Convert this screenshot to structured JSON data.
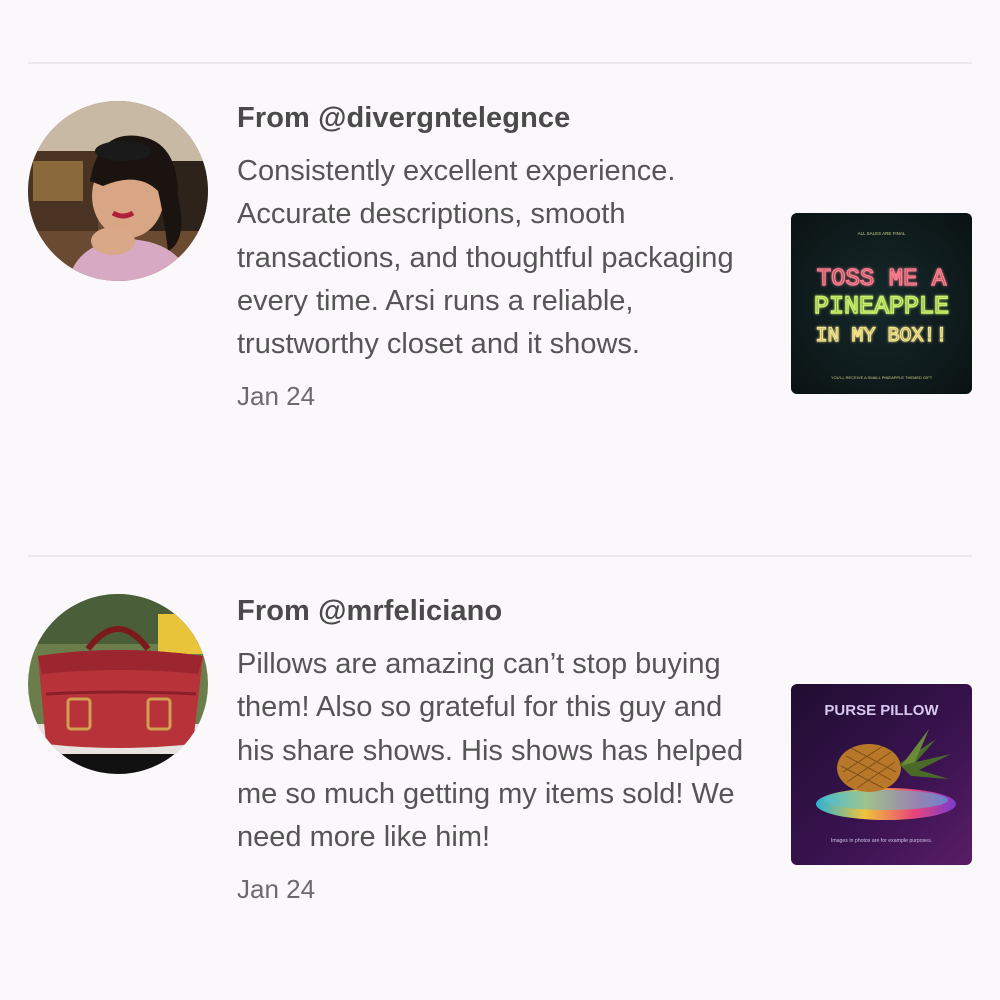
{
  "reviews": [
    {
      "from_prefix": "From ",
      "handle": "@divergntelegnce",
      "text": "Consistently excellent experience. Accurate descriptions, smooth transactions, and thoughtful packaging every time. Arsi runs a reliable, trustworthy closet and it shows.",
      "date": "Jan 24",
      "thumbnail": {
        "top_small": "ALL SALES ARE FINAL",
        "line1": "TOSS ME A",
        "line2": "PINEAPPLE",
        "line3": "IN MY BOX!!",
        "bottom_small": "YOU'LL RECEIVE A SMALL PINEAPPLE THEMED GIFT",
        "colors": {
          "background": "#0d1a1c",
          "pink": "#ff7e8f",
          "green": "#c9f26a",
          "yellow": "#f3e38a"
        }
      }
    },
    {
      "from_prefix": "From ",
      "handle": "@mrfeliciano",
      "text": "Pillows are amazing can’t stop buying them! Also so grateful for this guy and his share shows. His shows has helped me so much getting my items sold! We need more like him!",
      "date": "Jan 24",
      "thumbnail": {
        "title": "PURSE PILLOW",
        "caption": "Images in photos are for example purposes.",
        "colors": {
          "background": "#2a0f3a",
          "title": "#d8c8f0"
        }
      }
    }
  ]
}
